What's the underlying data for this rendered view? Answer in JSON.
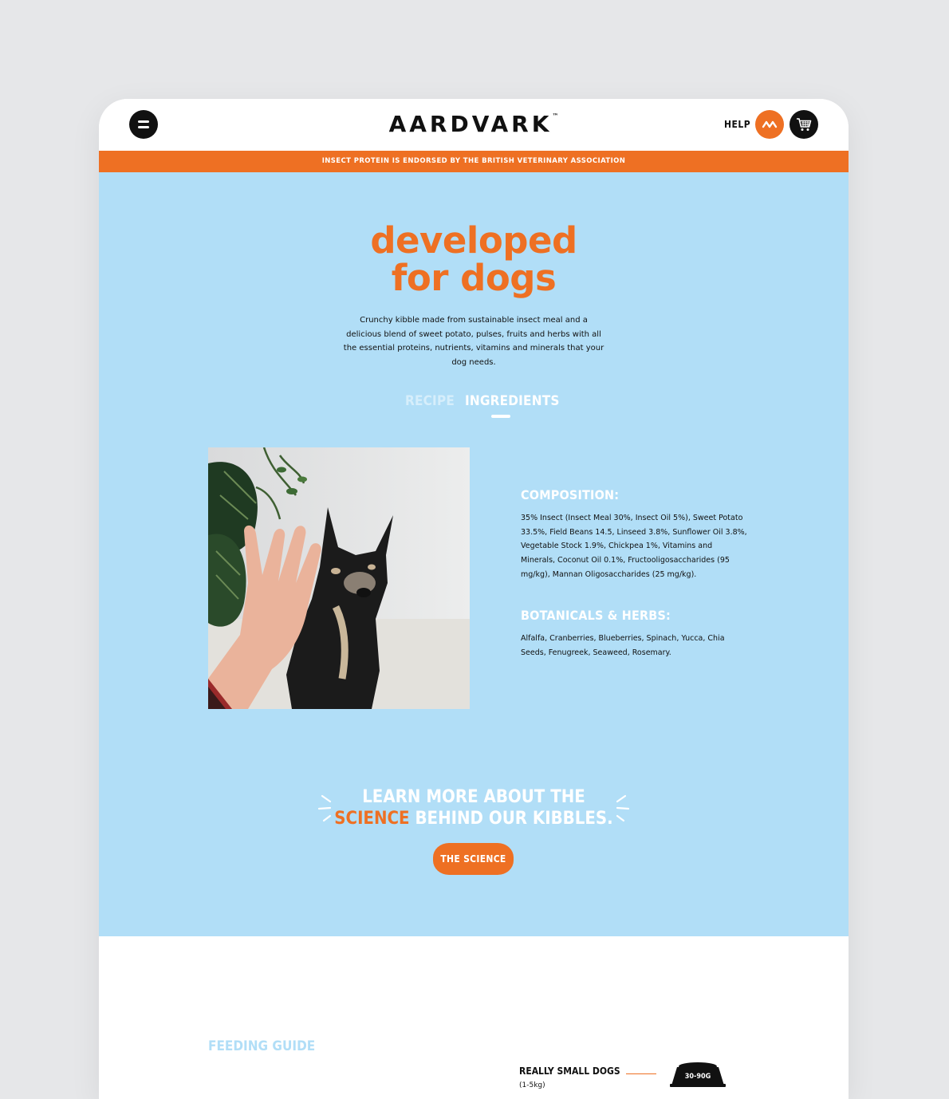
{
  "header": {
    "logo": "AARDVARK",
    "logo_tm": "™",
    "help": "HELP",
    "menu_icon": "menu-icon",
    "account_icon": "account-icon",
    "cart_icon": "cart-icon"
  },
  "announcement": "INSECT PROTEIN IS ENDORSED BY THE BRITISH VETERINARY ASSOCIATION",
  "hero": {
    "title_line1": "developed",
    "title_line2": "for dogs",
    "description": "Crunchy kibble made from sustainable insect meal and a delicious blend of sweet potato, pulses, fruits and herbs with all the essential proteins, nutrients, vitamins and minerals that your dog needs."
  },
  "tabs": [
    {
      "label": "RECIPE",
      "active": false
    },
    {
      "label": "INGREDIENTS",
      "active": true
    }
  ],
  "ingredients": {
    "composition_heading": "COMPOSITION:",
    "composition_text": "35% Insect (Insect Meal 30%, Insect Oil 5%), Sweet Potato 33.5%, Field Beans 14.5, Linseed 3.8%, Sunflower Oil 3.8%, Vegetable Stock 1.9%, Chickpea 1%, Vitamins and Minerals, Coconut Oil 0.1%, Fructooligosaccharides (95 mg/kg), Mannan Oligosaccharides (25 mg/kg).",
    "botanicals_heading": "BOTANICALS & HERBS:",
    "botanicals_text": "Alfalfa, Cranberries, Blueberries, Spinach, Yucca, Chia Seeds, Fenugreek, Seaweed, Rosemary."
  },
  "science": {
    "line1": "LEARN MORE ABOUT THE",
    "highlight": "SCIENCE",
    "line2_rest": " BEHIND OUR KIBBLES.",
    "button": "THE SCIENCE"
  },
  "feeding": {
    "title": "FEEDING GUIDE",
    "rows": [
      {
        "label": "REALLY SMALL DOGS",
        "weight": "(1-5kg)",
        "amount": "30-90G"
      }
    ]
  },
  "colors": {
    "accent": "#ee7023",
    "sky": "#b1def7",
    "dark": "#111111"
  }
}
